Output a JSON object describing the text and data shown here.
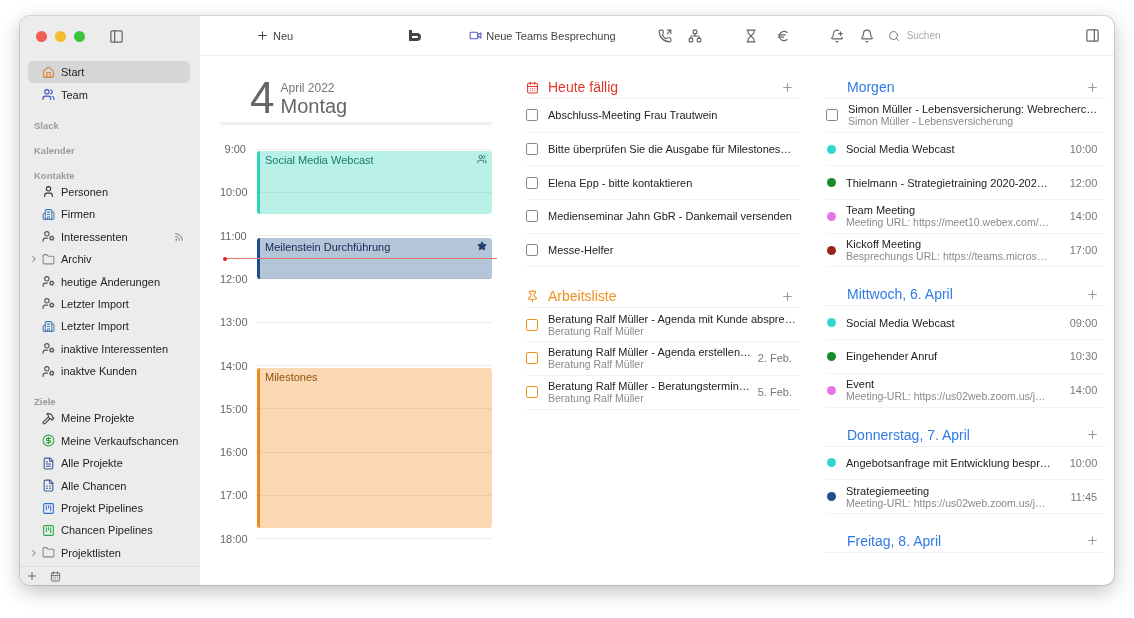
{
  "toolbar": {
    "new_button": "Neu",
    "teams_button": "Neue Teams Besprechung",
    "search": {
      "placeholder": "Suchen"
    }
  },
  "sidebar": {
    "groups": [
      {
        "items": [
          {
            "label": "Start",
            "kind": "home",
            "selected": true
          },
          {
            "label": "Team",
            "kind": "team",
            "selected": false
          }
        ]
      },
      {
        "title": "Slack"
      },
      {
        "title": "Kalender"
      },
      {
        "title": "Kontakte",
        "items": [
          {
            "label": "Personen",
            "kind": "person",
            "selected": false
          },
          {
            "label": "Firmen",
            "kind": "company",
            "selected": false
          },
          {
            "label": "Interessenten",
            "kind": "lead",
            "selected": false,
            "broadcast": true
          },
          {
            "label": "Archiv",
            "kind": "folder",
            "selected": false,
            "expanded": false
          },
          {
            "label": "heutige Änderungen",
            "kind": "lead",
            "selected": false
          },
          {
            "label": "Letzter Import",
            "kind": "lead",
            "selected": false
          },
          {
            "label": "Letzter Import",
            "kind": "company",
            "selected": false
          },
          {
            "label": "inaktive Interessenten",
            "kind": "lead",
            "selected": false
          },
          {
            "label": "inaktve Kunden",
            "kind": "lead",
            "selected": false
          }
        ]
      },
      {
        "title": "Ziele",
        "items": [
          {
            "label": "Meine Projekte",
            "kind": "project",
            "selected": false
          },
          {
            "label": "Meine Verkaufschancen",
            "kind": "opportunity",
            "selected": false
          },
          {
            "label": "Alle Projekte",
            "kind": "project-list",
            "selected": false
          },
          {
            "label": "Alle Chancen",
            "kind": "opportunity-list",
            "selected": false
          },
          {
            "label": "Projekt Pipelines",
            "kind": "project-pipeline",
            "selected": false
          },
          {
            "label": "Chancen Pipelines",
            "kind": "opportunity-pipeline",
            "selected": false
          },
          {
            "label": "Projektlisten",
            "kind": "folder",
            "selected": false,
            "expanded": false
          }
        ]
      }
    ]
  },
  "calendar": {
    "day": "4",
    "month_year": "April 2022",
    "weekday": "Montag",
    "hours": [
      "9:00",
      "10:00",
      "11:00",
      "12:00",
      "13:00",
      "14:00",
      "15:00",
      "16:00",
      "17:00",
      "18:00"
    ],
    "events": [
      {
        "title": "Social Media Webcast",
        "color": "#2ed3b7",
        "kind": "group"
      },
      {
        "title": "Meilenstein Durchführung",
        "color": "#1f4e8c",
        "kind": "milestone"
      },
      {
        "title": "Milestones",
        "color": "#f08a1c",
        "kind": "plain"
      }
    ]
  },
  "task_lists": [
    {
      "title": "Heute fällig",
      "kind": "due",
      "color": "#e0392b",
      "items": [
        {
          "title": "Abschluss-Meeting Frau Trautwein",
          "checked": false
        },
        {
          "title": "Bitte überprüfen Sie die Ausgabe für Milestones…",
          "checked": false
        },
        {
          "title": "Elena Epp - bitte kontaktieren",
          "checked": false
        },
        {
          "title": "Medienseminar Jahn GbR - Dankemail versenden",
          "checked": false
        },
        {
          "title": "Messe-Helfer",
          "checked": false
        }
      ]
    },
    {
      "title": "Arbeitsliste",
      "kind": "worklist",
      "color": "#f0901e",
      "items": [
        {
          "title": "Beratung Ralf Müller - Agenda mit Kunde abspre…",
          "subtitle": "Beratung Ralf Müller",
          "checked": false
        },
        {
          "title": "Beratung Ralf Müller - Agenda erstellen…",
          "subtitle": "Beratung Ralf Müller",
          "date": "2. Feb.",
          "checked": false
        },
        {
          "title": "Beratung Ralf Müller - Beratungstermin…",
          "subtitle": "Beratung Ralf Müller",
          "date": "5. Feb.",
          "checked": false
        }
      ]
    }
  ],
  "agenda": [
    {
      "title": "Morgen",
      "items": [
        {
          "kind": "task",
          "title": "Simon Müller - Lebensversicherung: Webrecherc…",
          "subtitle": "Simon Müller - Lebensversicherung",
          "checked": false
        },
        {
          "kind": "event",
          "title": "Social Media Webcast",
          "time": "10:00",
          "color": "#2ed8d0"
        },
        {
          "kind": "event",
          "title": "Thielmann - Strategietraining 2020-202…",
          "time": "12:00",
          "color": "#1a8a2a"
        },
        {
          "kind": "event",
          "title": "Team Meeting",
          "subtitle": "Meeting URL: https://meet10.webex.com/…",
          "time": "14:00",
          "color": "#e676e6"
        },
        {
          "kind": "event",
          "title": "Kickoff Meeting",
          "subtitle": "Besprechungs URL: https://teams.micros…",
          "time": "17:00",
          "color": "#9a2418"
        }
      ]
    },
    {
      "title": "Mittwoch, 6. April",
      "items": [
        {
          "kind": "event",
          "title": "Social Media Webcast",
          "time": "09:00",
          "color": "#2ed8d0"
        },
        {
          "kind": "event",
          "title": "Eingehender Anruf",
          "time": "10:30",
          "color": "#1a8a2a"
        },
        {
          "kind": "event",
          "title": "Event",
          "subtitle": "Meeting-URL: https://us02web.zoom.us/j…",
          "time": "14:00",
          "color": "#e676e6"
        }
      ]
    },
    {
      "title": "Donnerstag, 7. April",
      "items": [
        {
          "kind": "event",
          "title": "Angebotsanfrage mit Entwicklung bespr…",
          "time": "10:00",
          "color": "#2ed8d0"
        },
        {
          "kind": "event",
          "title": "Strategiemeeting",
          "subtitle": "Meeting-URL: https://us02web.zoom.us/j…",
          "time": "11:45",
          "color": "#1f4e8c"
        }
      ]
    },
    {
      "title": "Freitag, 8. April"
    }
  ]
}
